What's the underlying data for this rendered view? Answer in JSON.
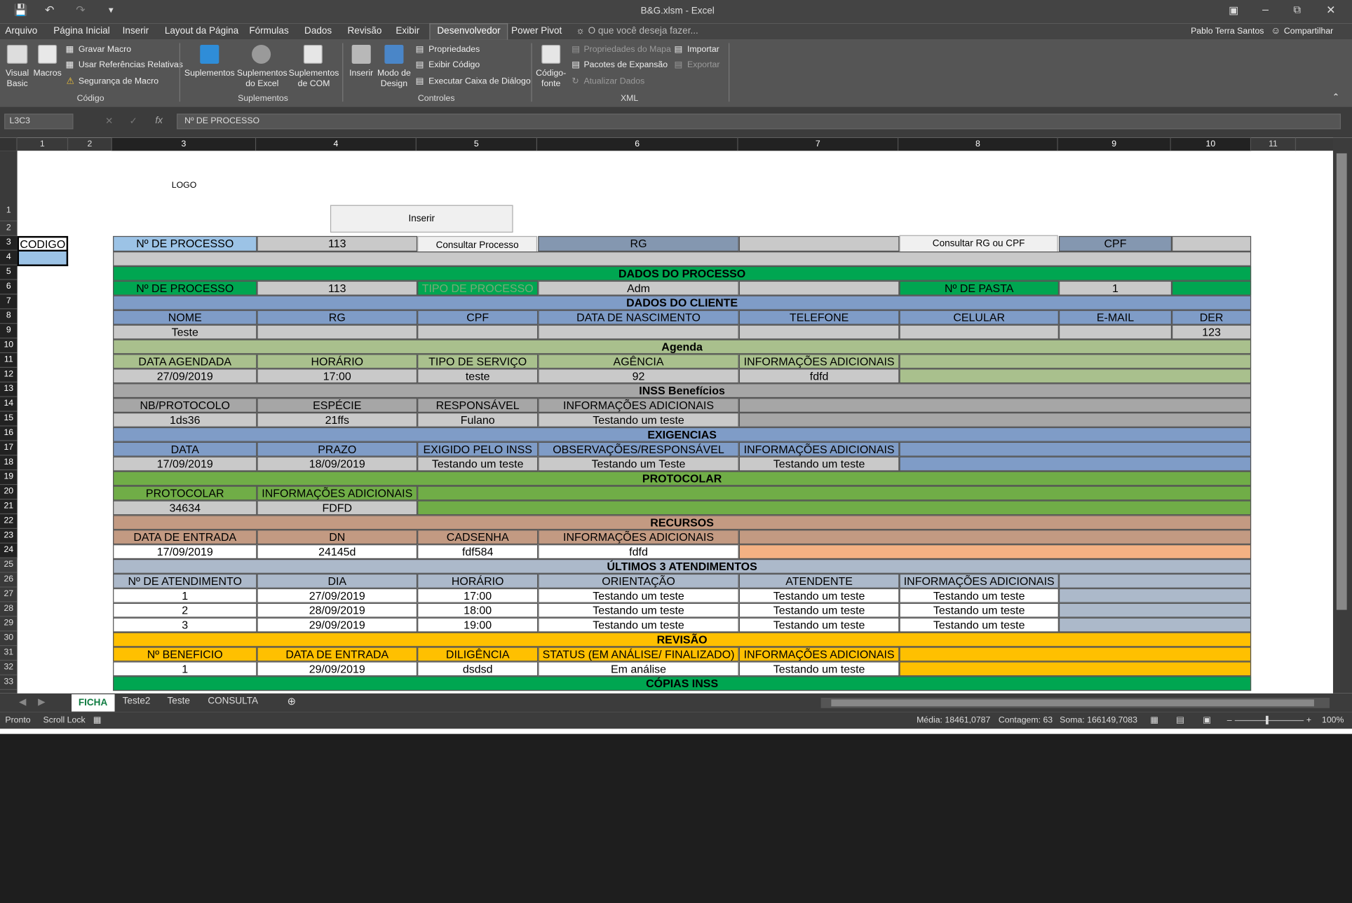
{
  "window": {
    "title": "B&G.xlsm - Excel",
    "user": "Pablo Terra Santos",
    "share": "Compartilhar",
    "search": "O que você deseja fazer..."
  },
  "tabs": [
    "Arquivo",
    "Página Inicial",
    "Inserir",
    "Layout da Página",
    "Fórmulas",
    "Dados",
    "Revisão",
    "Exibir",
    "Desenvolvedor",
    "Power Pivot"
  ],
  "ribbon": {
    "codigo": {
      "visual_basic": "Visual Basic",
      "macros": "Macros",
      "gravar": "Gravar Macro",
      "usar_ref": "Usar Referências Relativas",
      "seguranca": "Segurança de Macro",
      "label": "Código"
    },
    "suplementos": {
      "sup": "Suplementos",
      "sup_excel": "Suplementos do Excel",
      "sup_com": "Suplementos de COM",
      "label": "Suplementos"
    },
    "controles": {
      "inserir": "Inserir",
      "modo": "Modo de Design",
      "propriedades": "Propriedades",
      "exibir_codigo": "Exibir Código",
      "executar": "Executar Caixa de Diálogo",
      "label": "Controles"
    },
    "xml": {
      "codigo_fonte": "Código-fonte",
      "prop_mapa": "Propriedades do Mapa",
      "pacotes": "Pacotes de Expansão",
      "atualizar": "Atualizar Dados",
      "importar": "Importar",
      "exportar": "Exportar",
      "label": "XML"
    }
  },
  "formula_bar": {
    "name_box": "L3C3",
    "fx": "fx",
    "value": "Nº DE PROCESSO"
  },
  "columns": [
    "1",
    "2",
    "3",
    "4",
    "5",
    "6",
    "7",
    "8",
    "9",
    "10",
    "11"
  ],
  "rows": [
    "1",
    "2",
    "3",
    "4",
    "5",
    "6",
    "7",
    "8",
    "9",
    "10",
    "11",
    "12",
    "13",
    "14",
    "15",
    "16",
    "17",
    "18",
    "19",
    "20",
    "21",
    "22",
    "23",
    "24",
    "25",
    "26",
    "27",
    "28",
    "29",
    "30",
    "31",
    "32",
    "33"
  ],
  "sheet": {
    "logo": "LOGO",
    "btn_inserir": "Inserir",
    "btn_consultar_processo": "Consultar Processo",
    "btn_consultar_rg": "Consultar RG ou CPF",
    "codigo": "CODIGO",
    "r3": {
      "nproc_label": "Nº DE PROCESSO",
      "nproc_val": "113",
      "rg": "RG",
      "cpf": "CPF"
    },
    "dados_processo": "DADOS DO PROCESSO",
    "r6": {
      "nproc": "Nº DE PROCESSO",
      "nproc_val": "113",
      "tipo": "TIPO DE PROCESSO",
      "tipo_val": "Adm",
      "pasta": "Nº DE PASTA",
      "pasta_val": "1"
    },
    "dados_cliente": "DADOS DO CLIENTE",
    "r8": [
      "NOME",
      "RG",
      "CPF",
      "DATA DE NASCIMENTO",
      "TELEFONE",
      "CELULAR",
      "E-MAIL",
      "DER"
    ],
    "r9": {
      "nome": "Teste",
      "der": "123"
    },
    "agenda": "Agenda",
    "r11": [
      "DATA AGENDADA",
      "HORÁRIO",
      "TIPO DE SERVIÇO",
      "AGÊNCIA",
      "INFORMAÇÕES ADICIONAIS"
    ],
    "r12": [
      "27/09/2019",
      "17:00",
      "teste",
      "92",
      "fdfd"
    ],
    "inss": "INSS Benefícios",
    "r14": [
      "NB/PROTOCOLO",
      "ESPÉCIE",
      "RESPONSÁVEL",
      "INFORMAÇÕES ADICIONAIS"
    ],
    "r15": [
      "1ds36",
      "21ffs",
      "Fulano",
      "Testando um teste"
    ],
    "exigencias": "EXIGENCIAS",
    "r17": [
      "DATA",
      "PRAZO",
      "EXIGIDO PELO INSS",
      "OBSERVAÇÕES/RESPONSÁVEL",
      "INFORMAÇÕES ADICIONAIS"
    ],
    "r18": [
      "17/09/2019",
      "18/09/2019",
      "Testando um teste",
      "Testando um Teste",
      "Testando um teste"
    ],
    "protocolar": "PROTOCOLAR",
    "r20": [
      "PROTOCOLAR",
      "INFORMAÇÕES ADICIONAIS"
    ],
    "r21": [
      "34634",
      "FDFD"
    ],
    "recursos": "RECURSOS",
    "r23": [
      "DATA DE ENTRADA",
      "DN",
      "CADSENHA",
      "INFORMAÇÕES ADICIONAIS"
    ],
    "r24": [
      "17/09/2019",
      "24145d",
      "fdf584",
      "fdfd"
    ],
    "ultimos": "ÚLTIMOS 3 ATENDIMENTOS",
    "r26": [
      "Nº DE ATENDIMENTO",
      "DIA",
      "HORÁRIO",
      "ORIENTAÇÃO",
      "ATENDENTE",
      "INFORMAÇÕES ADICIONAIS"
    ],
    "r27": [
      "1",
      "27/09/2019",
      "17:00",
      "Testando um teste",
      "Testando um teste",
      "Testando um teste"
    ],
    "r28": [
      "2",
      "28/09/2019",
      "18:00",
      "Testando um teste",
      "Testando um teste",
      "Testando um teste"
    ],
    "r29": [
      "3",
      "29/09/2019",
      "19:00",
      "Testando um teste",
      "Testando um teste",
      "Testando um teste"
    ],
    "revisao": "REVISÃO",
    "r31": [
      "Nº BENEFICIO",
      "DATA DE ENTRADA",
      "DILIGÊNCIA",
      "STATUS (EM ANÁLISE/ FINALIZADO)",
      "INFORMAÇÕES ADICIONAIS"
    ],
    "r32": [
      "1",
      "29/09/2019",
      "dsdsd",
      "Em análise",
      "Testando um teste"
    ],
    "copias": "CÓPIAS INSS"
  },
  "sheet_tabs": [
    "FICHA",
    "Teste2",
    "Teste",
    "CONSULTA"
  ],
  "status": {
    "pronto": "Pronto",
    "scroll": "Scroll Lock",
    "media": "Média: 18461,0787",
    "contagem": "Contagem: 63",
    "soma": "Soma: 166149,7083",
    "zoom": "100%"
  }
}
